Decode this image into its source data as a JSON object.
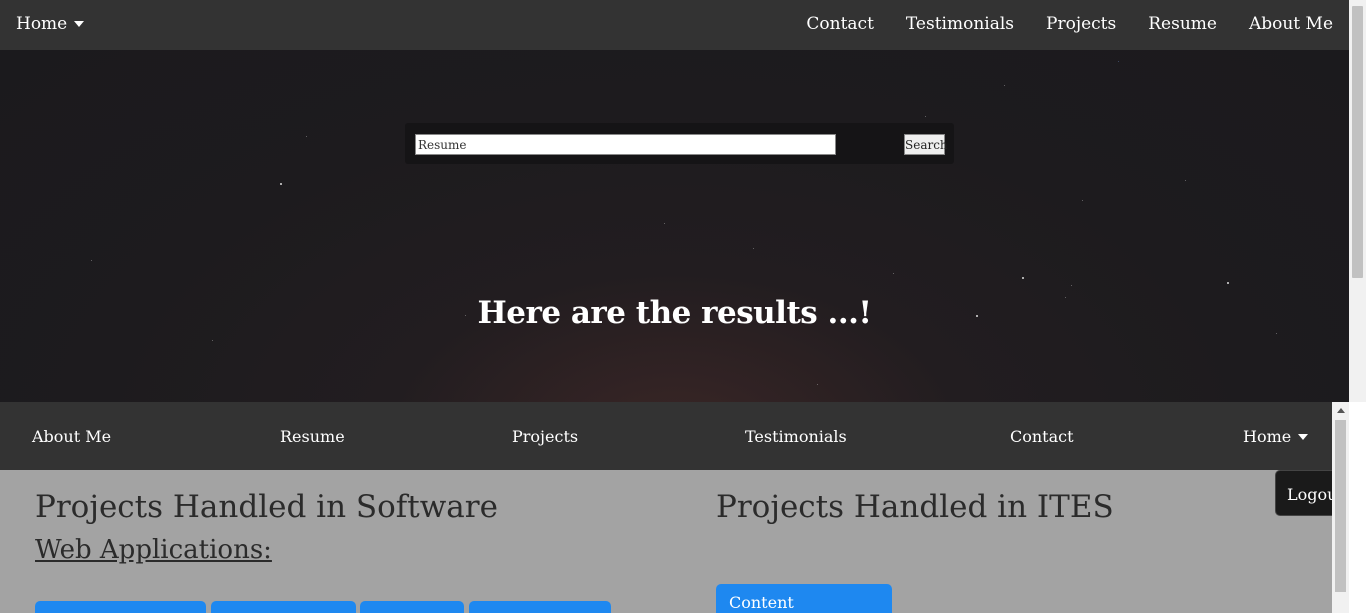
{
  "top_nav": {
    "home_label": "Home",
    "links": [
      "Contact",
      "Testimonials",
      "Projects",
      "Resume",
      "About Me"
    ]
  },
  "search": {
    "value": "Resume",
    "button_label": "Search"
  },
  "hero": {
    "heading": "Here are the results ...!"
  },
  "sub_nav": {
    "links": [
      "About Me",
      "Resume",
      "Projects",
      "Testimonials",
      "Contact"
    ],
    "home_label": "Home"
  },
  "software": {
    "title": "Projects Handled in Software",
    "subheading": "Web Applications:"
  },
  "ites": {
    "title": "Projects Handled in ITES",
    "button_label": "Content Management"
  },
  "logout_label": "Logout",
  "colors": {
    "nav_bg": "#333333",
    "content_bg": "#a3a3a3",
    "accent_blue": "#1e88f0"
  },
  "icons": [
    "caret-down-icon"
  ]
}
